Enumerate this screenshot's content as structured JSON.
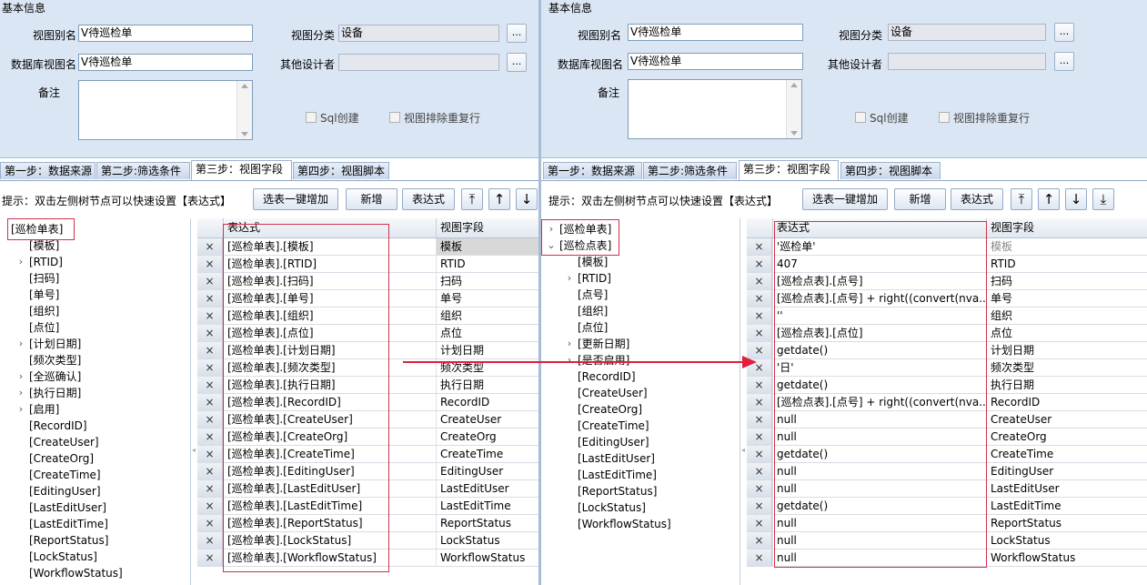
{
  "left": {
    "section_title": "基本信息",
    "labels": {
      "alias": "视图别名",
      "category": "视图分类",
      "db_view_name": "数据库视图名",
      "other_designers": "其他设计者",
      "remark": "备注"
    },
    "values": {
      "alias": "V待巡检单",
      "category": "设备",
      "db_view_name": "V待巡检单",
      "other_designers": ""
    },
    "ellipsis": "...",
    "checkboxes": {
      "sql_create": "Sql创建",
      "exclude_dup": "视图排除重复行"
    },
    "tabs": [
      "第一步：数据来源",
      "第二步:筛选条件",
      "第三步：视图字段",
      "第四步：视图脚本"
    ],
    "hint": "提示：双击左侧树节点可以快速设置【表达式】",
    "buttons": {
      "add_all": "选表一键增加",
      "add": "新增",
      "expr": "表达式"
    },
    "arrows": [
      "⤒",
      "↑",
      "↓"
    ],
    "tree": [
      {
        "label": "[巡检单表]",
        "arrow": "",
        "level": 0
      },
      {
        "label": "[模板]",
        "arrow": "",
        "level": 1
      },
      {
        "label": "[RTID]",
        "arrow": "›",
        "level": 1
      },
      {
        "label": "[扫码]",
        "arrow": "",
        "level": 1
      },
      {
        "label": "[单号]",
        "arrow": "",
        "level": 1
      },
      {
        "label": "[组织]",
        "arrow": "",
        "level": 1
      },
      {
        "label": "[点位]",
        "arrow": "",
        "level": 1
      },
      {
        "label": "[计划日期]",
        "arrow": "›",
        "level": 1
      },
      {
        "label": "[频次类型]",
        "arrow": "",
        "level": 1
      },
      {
        "label": "[全巡确认]",
        "arrow": "›",
        "level": 1
      },
      {
        "label": "[执行日期]",
        "arrow": "›",
        "level": 1
      },
      {
        "label": "[启用]",
        "arrow": "›",
        "level": 1
      },
      {
        "label": "[RecordID]",
        "arrow": "",
        "level": 1
      },
      {
        "label": "[CreateUser]",
        "arrow": "",
        "level": 1
      },
      {
        "label": "[CreateOrg]",
        "arrow": "",
        "level": 1
      },
      {
        "label": "[CreateTime]",
        "arrow": "",
        "level": 1
      },
      {
        "label": "[EditingUser]",
        "arrow": "",
        "level": 1
      },
      {
        "label": "[LastEditUser]",
        "arrow": "",
        "level": 1
      },
      {
        "label": "[LastEditTime]",
        "arrow": "",
        "level": 1
      },
      {
        "label": "[ReportStatus]",
        "arrow": "",
        "level": 1
      },
      {
        "label": "[LockStatus]",
        "arrow": "",
        "level": 1
      },
      {
        "label": "[WorkflowStatus]",
        "arrow": "",
        "level": 1
      }
    ],
    "grid_headers": {
      "expr": "表达式",
      "field": "视图字段"
    },
    "delete_glyph": "×",
    "rows": [
      {
        "expr": "[巡检单表].[模板]",
        "field": "模板"
      },
      {
        "expr": "[巡检单表].[RTID]",
        "field": "RTID"
      },
      {
        "expr": "[巡检单表].[扫码]",
        "field": "扫码"
      },
      {
        "expr": "[巡检单表].[单号]",
        "field": "单号"
      },
      {
        "expr": "[巡检单表].[组织]",
        "field": "组织"
      },
      {
        "expr": "[巡检单表].[点位]",
        "field": "点位"
      },
      {
        "expr": "[巡检单表].[计划日期]",
        "field": "计划日期"
      },
      {
        "expr": "[巡检单表].[频次类型]",
        "field": "频次类型"
      },
      {
        "expr": "[巡检单表].[执行日期]",
        "field": "执行日期"
      },
      {
        "expr": "[巡检单表].[RecordID]",
        "field": "RecordID"
      },
      {
        "expr": "[巡检单表].[CreateUser]",
        "field": "CreateUser"
      },
      {
        "expr": "[巡检单表].[CreateOrg]",
        "field": "CreateOrg"
      },
      {
        "expr": "[巡检单表].[CreateTime]",
        "field": "CreateTime"
      },
      {
        "expr": "[巡检单表].[EditingUser]",
        "field": "EditingUser"
      },
      {
        "expr": "[巡检单表].[LastEditUser]",
        "field": "LastEditUser"
      },
      {
        "expr": "[巡检单表].[LastEditTime]",
        "field": "LastEditTime"
      },
      {
        "expr": "[巡检单表].[ReportStatus]",
        "field": "ReportStatus"
      },
      {
        "expr": "[巡检单表].[LockStatus]",
        "field": "LockStatus"
      },
      {
        "expr": "[巡检单表].[WorkflowStatus]",
        "field": "WorkflowStatus"
      }
    ]
  },
  "right": {
    "section_title": "基本信息",
    "labels": {
      "alias": "视图别名",
      "category": "视图分类",
      "db_view_name": "数据库视图名",
      "other_designers": "其他设计者",
      "remark": "备注"
    },
    "values": {
      "alias": "V待巡检单",
      "category": "设备",
      "db_view_name": "V待巡检单",
      "other_designers": ""
    },
    "ellipsis": "...",
    "checkboxes": {
      "sql_create": "Sql创建",
      "exclude_dup": "视图排除重复行"
    },
    "tabs": [
      "第一步：数据来源",
      "第二步:筛选条件",
      "第三步：视图字段",
      "第四步：视图脚本"
    ],
    "hint": "提示：双击左侧树节点可以快速设置【表达式】",
    "buttons": {
      "add_all": "选表一键增加",
      "add": "新增",
      "expr": "表达式"
    },
    "arrows": [
      "⤒",
      "↑",
      "↓",
      "⤓"
    ],
    "tree": [
      {
        "label": "[巡检单表]",
        "arrow": "›",
        "level": 0
      },
      {
        "label": "[巡检点表]",
        "arrow": "⌄",
        "level": 0
      },
      {
        "label": "[模板]",
        "arrow": "",
        "level": 1
      },
      {
        "label": "[RTID]",
        "arrow": "›",
        "level": 1
      },
      {
        "label": "[点号]",
        "arrow": "",
        "level": 1
      },
      {
        "label": "[组织]",
        "arrow": "",
        "level": 1
      },
      {
        "label": "[点位]",
        "arrow": "",
        "level": 1
      },
      {
        "label": "[更新日期]",
        "arrow": "›",
        "level": 1
      },
      {
        "label": "[是否启用]",
        "arrow": "›",
        "level": 1
      },
      {
        "label": "[RecordID]",
        "arrow": "",
        "level": 1
      },
      {
        "label": "[CreateUser]",
        "arrow": "",
        "level": 1
      },
      {
        "label": "[CreateOrg]",
        "arrow": "",
        "level": 1
      },
      {
        "label": "[CreateTime]",
        "arrow": "",
        "level": 1
      },
      {
        "label": "[EditingUser]",
        "arrow": "",
        "level": 1
      },
      {
        "label": "[LastEditUser]",
        "arrow": "",
        "level": 1
      },
      {
        "label": "[LastEditTime]",
        "arrow": "",
        "level": 1
      },
      {
        "label": "[ReportStatus]",
        "arrow": "",
        "level": 1
      },
      {
        "label": "[LockStatus]",
        "arrow": "",
        "level": 1
      },
      {
        "label": "[WorkflowStatus]",
        "arrow": "",
        "level": 1
      }
    ],
    "grid_headers": {
      "expr": "表达式",
      "field": "视图字段"
    },
    "delete_glyph": "×",
    "rows": [
      {
        "expr": "'巡检单'",
        "field": "模板"
      },
      {
        "expr": "407",
        "field": "RTID"
      },
      {
        "expr": "[巡检点表].[点号]",
        "field": "扫码"
      },
      {
        "expr": "[巡检点表].[点号] + right((convert(nva...",
        "field": "单号"
      },
      {
        "expr": "''",
        "field": "组织"
      },
      {
        "expr": "[巡检点表].[点位]",
        "field": "点位"
      },
      {
        "expr": "getdate()",
        "field": "计划日期"
      },
      {
        "expr": "'日'",
        "field": "频次类型"
      },
      {
        "expr": "getdate()",
        "field": "执行日期"
      },
      {
        "expr": "[巡检点表].[点号] + right((convert(nva...",
        "field": "RecordID"
      },
      {
        "expr": "null",
        "field": "CreateUser"
      },
      {
        "expr": "null",
        "field": "CreateOrg"
      },
      {
        "expr": "getdate()",
        "field": "CreateTime"
      },
      {
        "expr": "null",
        "field": "EditingUser"
      },
      {
        "expr": "null",
        "field": "LastEditUser"
      },
      {
        "expr": "getdate()",
        "field": "LastEditTime"
      },
      {
        "expr": "null",
        "field": "ReportStatus"
      },
      {
        "expr": "null",
        "field": "LockStatus"
      },
      {
        "expr": "null",
        "field": "WorkflowStatus"
      }
    ]
  },
  "colors": {
    "panel_bg": "#dbe6f4",
    "annotation_red": "#d0314a",
    "arrow_red": "#e0203a"
  }
}
